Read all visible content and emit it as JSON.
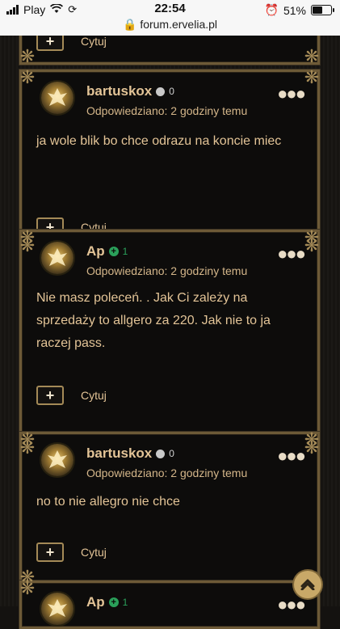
{
  "status": {
    "carrier": "Play",
    "time": "22:54",
    "battery": "51%",
    "url": "forum.ervelia.pl"
  },
  "top_partial": {
    "quote_label": "Cytuj"
  },
  "posts": [
    {
      "username": "bartuskox",
      "reputation": "0",
      "reputation_style": "neutral",
      "meta": "Odpowiedziano: 2 godziny temu",
      "content": "ja wole blik bo chce odrazu na koncie miec",
      "quote_label": "Cytuj"
    },
    {
      "username": "Ap",
      "reputation": "1",
      "reputation_style": "positive",
      "meta": "Odpowiedziano: 2 godziny temu",
      "content": "Nie masz poleceń. . Jak Ci zależy na sprzedaży to allgero za 220. Jak nie to ja raczej pass.",
      "quote_label": "Cytuj"
    },
    {
      "username": "bartuskox",
      "reputation": "0",
      "reputation_style": "neutral",
      "meta": "Odpowiedziano: 2 godziny temu",
      "content": "no to nie allegro nie chce",
      "quote_label": "Cytuj"
    },
    {
      "username": "Ap",
      "reputation": "1",
      "reputation_style": "positive"
    }
  ],
  "colors": {
    "accent_gold": "#e3c497",
    "frame": "#6d5a37",
    "positive": "#2aa05a"
  },
  "icons": {
    "more": "more-options-icon",
    "quote": "quote-plus-icon",
    "scroll_top": "chevron-up-icon"
  }
}
